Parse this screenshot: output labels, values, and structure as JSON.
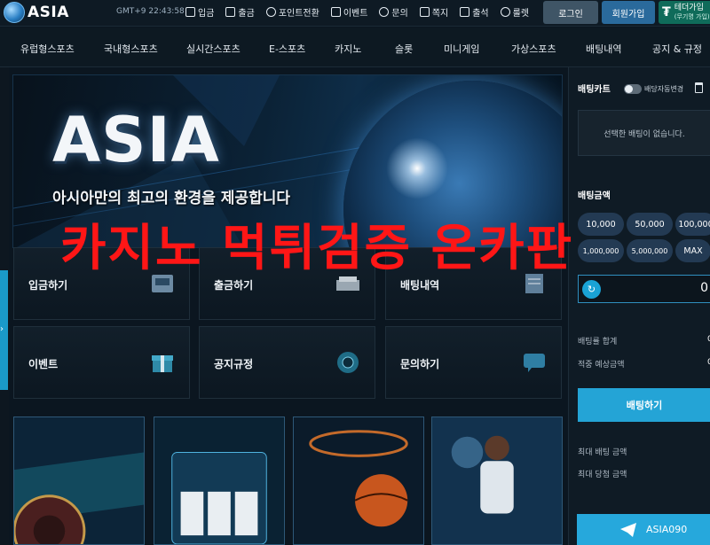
{
  "brand": {
    "name": "ASIA"
  },
  "clock": "GMT+9 22:43:58",
  "topmenu": [
    {
      "label": "입금",
      "icon": "deposit-icon"
    },
    {
      "label": "출금",
      "icon": "withdraw-icon"
    },
    {
      "label": "포인트전환",
      "icon": "point-icon"
    },
    {
      "label": "이벤트",
      "icon": "gift-icon"
    },
    {
      "label": "문의",
      "icon": "headset-icon"
    },
    {
      "label": "쪽지",
      "icon": "mail-icon"
    },
    {
      "label": "출석",
      "icon": "calendar-check-icon"
    },
    {
      "label": "룰렛",
      "icon": "roulette-icon"
    }
  ],
  "auth": {
    "login": "로그인",
    "join": "회원가입",
    "tether_title": "테더가입",
    "tether_sub": "(무기명 가입)",
    "tether_symbol": "₮"
  },
  "nav": [
    "유럽형스포츠",
    "국내형스포츠",
    "실시간스포츠",
    "E-스포츠",
    "카지노",
    "슬롯",
    "미니게임",
    "가상스포츠",
    "배팅내역",
    "공지 & 규정"
  ],
  "banner": {
    "logo": "ASIA",
    "subtitle": "아시아만의 최고의 환경을 제공합니다"
  },
  "watermark": "카지노 먹튀검증 온카판",
  "tiles": [
    {
      "label": "입금하기",
      "icon": "deposit-machine-icon"
    },
    {
      "label": "출금하기",
      "icon": "cash-stack-icon"
    },
    {
      "label": "배팅내역",
      "icon": "betting-history-icon"
    },
    {
      "label": "이벤트",
      "icon": "gift-box-icon"
    },
    {
      "label": "공지규정",
      "icon": "roulette-wheel-icon"
    },
    {
      "label": "문의하기",
      "icon": "chat-icon"
    }
  ],
  "betslip": {
    "title": "배팅카트",
    "auto_change": "배당자동변경",
    "empty": "선택한 배팅이 없습니다.",
    "amount_title": "배팅금액",
    "chips": [
      "10,000",
      "50,000",
      "100,000",
      "1,000,000",
      "5,000,000",
      "MAX"
    ],
    "amount_value": "0",
    "total_odds_label": "배팅률 합계",
    "total_odds_value": "0",
    "expected_label": "적중 예상금액",
    "expected_value": "0",
    "bet_button": "배팅하기",
    "max_bet_label": "최대 배팅 금액",
    "max_win_label": "최대 당첨 금액"
  },
  "telegram": {
    "label": "ASIA090",
    "icon": "telegram-icon"
  },
  "colors": {
    "accent": "#24a4d6",
    "watermark": "#ff1616",
    "join": "#2a6a9c",
    "tether": "#0f6b5a"
  }
}
